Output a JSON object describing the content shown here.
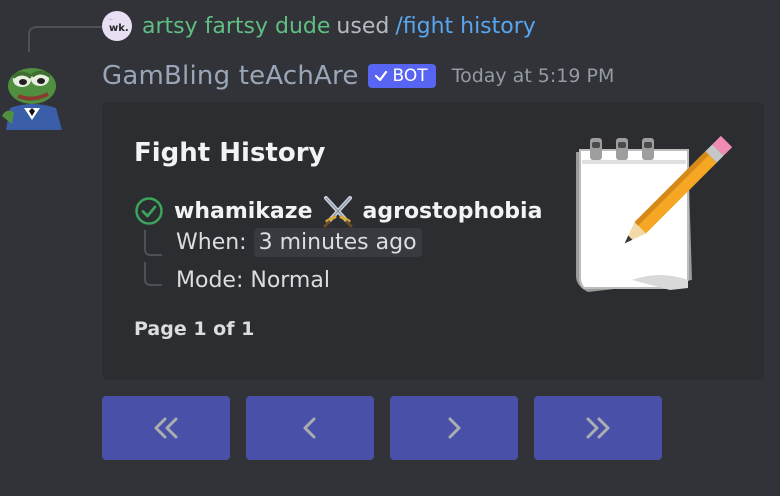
{
  "reply": {
    "avatar_text": "wk.",
    "username": "artsy fartsy dude",
    "used_text": "used",
    "command": "/fight history"
  },
  "message": {
    "bot_name": "GamBling teAchAre",
    "bot_tag": "BOT",
    "timestamp": "Today at 5:19 PM"
  },
  "embed": {
    "title": "Fight History",
    "fighter_one": "whamikaze",
    "fighter_two": "agrostophobia",
    "when_label": "When:",
    "when_value": "3 minutes ago",
    "mode_label": "Mode:",
    "mode_value": "Normal",
    "footer": "Page 1 of 1",
    "thumbnail_icon": "notepad-pencil-icon"
  },
  "buttons": [
    {
      "icon": "double-chevron-left-icon"
    },
    {
      "icon": "chevron-left-icon"
    },
    {
      "icon": "chevron-right-icon"
    },
    {
      "icon": "double-chevron-right-icon"
    }
  ],
  "colors": {
    "background": "#313338",
    "embed_bg": "#2b2d31",
    "blurple": "#5865f2",
    "username_green": "#5fbf83",
    "command_blue": "#58a6ef",
    "success_green": "#3ba55c"
  }
}
